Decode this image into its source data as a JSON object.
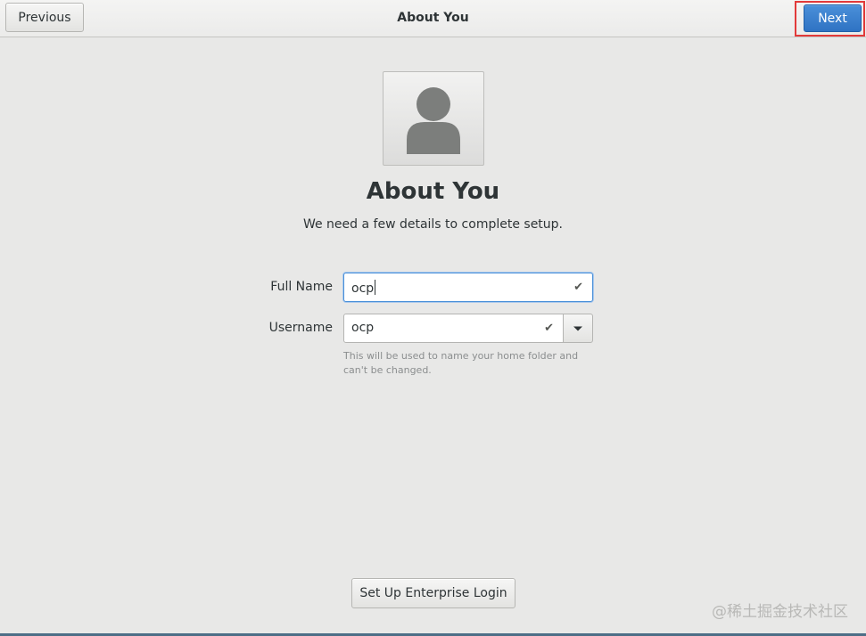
{
  "header": {
    "previous_label": "Previous",
    "title": "About You",
    "next_label": "Next"
  },
  "avatar": {
    "icon": "avatar-placeholder-icon"
  },
  "main": {
    "title": "About You",
    "subtitle": "We need a few details to complete setup."
  },
  "form": {
    "full_name_label": "Full Name",
    "full_name_value": "ocp",
    "username_label": "Username",
    "username_value": "ocp",
    "username_hint": "This will be used to name your home folder and can't be changed.",
    "check_icon": "✔"
  },
  "footer": {
    "enterprise_label": "Set Up Enterprise Login"
  },
  "watermark": "@稀土掘金技术社区",
  "colors": {
    "accent": "#3584e4",
    "highlight": "#e23a3a"
  }
}
